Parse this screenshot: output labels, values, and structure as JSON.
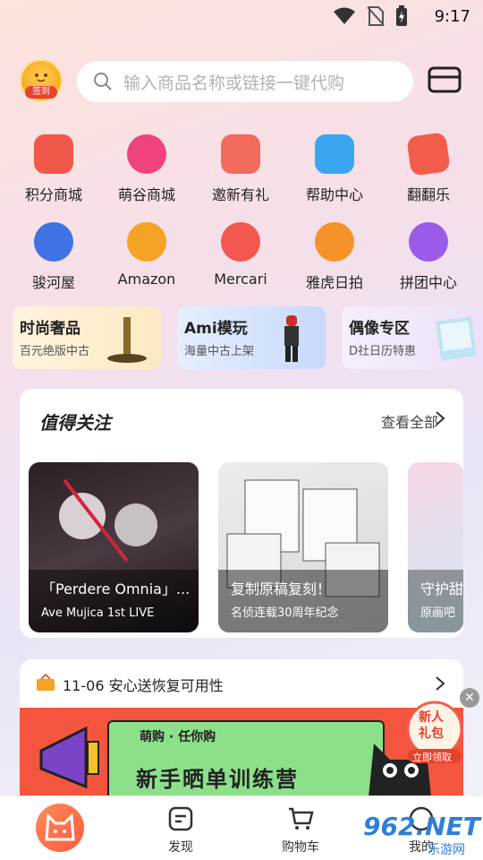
{
  "status": {
    "time": "9:17"
  },
  "topbar": {
    "checkin_label": "签到",
    "search_placeholder": "输入商品名称或链接一键代购"
  },
  "grid": [
    {
      "label": "积分商城",
      "icon": "gift-shop-icon",
      "color": "#f0584a"
    },
    {
      "label": "萌谷商城",
      "icon": "bunny-icon",
      "color": "#f0427d"
    },
    {
      "label": "邀新有礼",
      "icon": "coupon-icon",
      "color": "#f36a5e"
    },
    {
      "label": "帮助中心",
      "icon": "help-book-icon",
      "color": "#3aa6ef"
    },
    {
      "label": "翻翻乐",
      "icon": "flip-cards-icon",
      "color": "#f25d4b"
    },
    {
      "label": "骏河屋",
      "icon": "surugaya-icon",
      "color": "#3f72e3"
    },
    {
      "label": "Amazon",
      "icon": "amazon-icon",
      "color": "#f5a324"
    },
    {
      "label": "Mercari",
      "icon": "mercari-icon",
      "color": "#f2584f"
    },
    {
      "label": "雅虎日拍",
      "icon": "yahoo-auction-icon",
      "color": "#f5932a"
    },
    {
      "label": "拼团中心",
      "icon": "group-buy-icon",
      "color": "#9a5ce8"
    }
  ],
  "promos": [
    {
      "title": "时尚奢品",
      "sub": "百元绝版中古"
    },
    {
      "title": "Ami模玩",
      "sub": "海量中古上架"
    },
    {
      "title": "偶像专区",
      "sub": "D社日历特惠"
    }
  ],
  "featured": {
    "title": "值得关注",
    "more": "查看全部",
    "cards": [
      {
        "title": "「Perdere Omnia」...",
        "sub": "Ave Mujica 1st LIVE"
      },
      {
        "title": "复制原稿复刻！",
        "sub": "名侦连载30周年纪念"
      },
      {
        "title": "守护甜",
        "sub": "原画吧"
      }
    ]
  },
  "notice": {
    "text": "11-06 安心送恢复可用性",
    "banner_tag": "萌购 · 任你购",
    "banner_title": "新手晒单训练营"
  },
  "float_gift": {
    "line1": "新人",
    "line2": "礼包",
    "cta": "立即领取"
  },
  "tabs": [
    {
      "label": "发现"
    },
    {
      "label": "购物车"
    },
    {
      "label": "我的"
    }
  ],
  "watermark": {
    "text": "962.NET",
    "sub": "乐游网"
  }
}
